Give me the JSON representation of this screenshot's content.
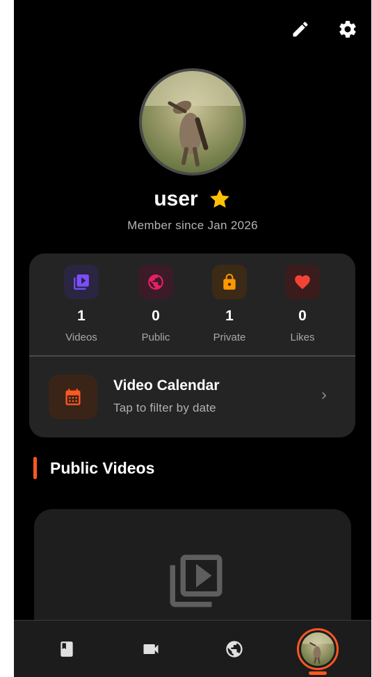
{
  "profile": {
    "username": "user",
    "member_since": "Member since Jan 2026"
  },
  "stats": [
    {
      "icon": "video-library-icon",
      "value": "1",
      "label": "Videos",
      "color": "#7c4dff",
      "bg": "#2a2540"
    },
    {
      "icon": "globe-icon",
      "value": "0",
      "label": "Public",
      "color": "#e91e63",
      "bg": "#3a1b27"
    },
    {
      "icon": "lock-icon",
      "value": "1",
      "label": "Private",
      "color": "#ff9800",
      "bg": "#3b2a16"
    },
    {
      "icon": "heart-icon",
      "value": "0",
      "label": "Likes",
      "color": "#f44336",
      "bg": "#3a1c1c"
    }
  ],
  "calendar": {
    "title": "Video Calendar",
    "subtitle": "Tap to filter by date",
    "icon": "calendar-icon",
    "color": "#ff5722"
  },
  "section": {
    "title": "Public Videos"
  },
  "empty_state": {
    "icon": "video-library-icon"
  },
  "bottom_nav": [
    {
      "icon": "book-icon"
    },
    {
      "icon": "video-camera-icon"
    },
    {
      "icon": "globe-icon"
    },
    {
      "icon": "avatar",
      "active": true
    }
  ],
  "colors": {
    "accent": "#ff5722",
    "star": "#ffc107"
  }
}
